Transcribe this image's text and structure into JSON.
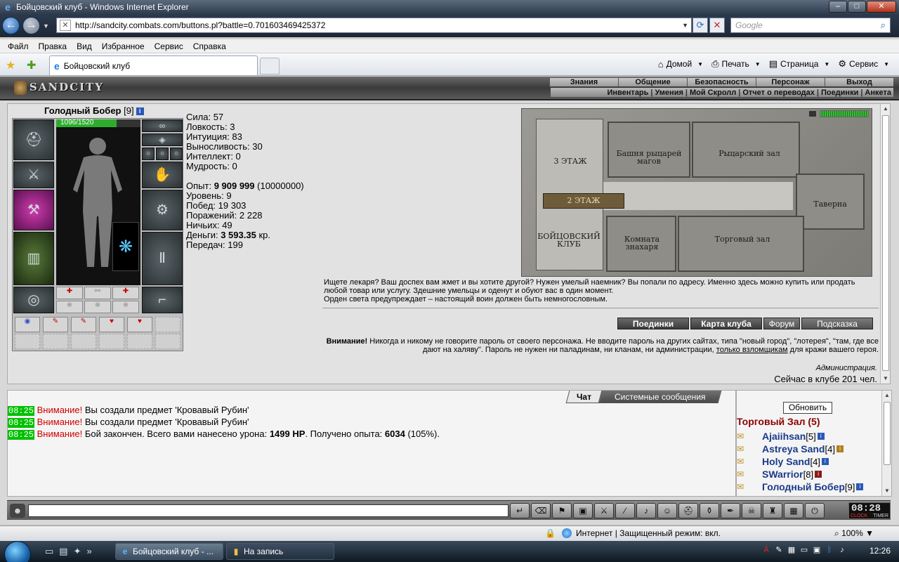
{
  "window": {
    "title": "Бойцовский клуб - Windows Internet Explorer",
    "min": "–",
    "max": "□",
    "close": "✕"
  },
  "address": {
    "url": "http://sandcity.combats.com/buttons.pl?battle=0.701603469425372",
    "search_placeholder": "Google"
  },
  "menu": [
    "Файл",
    "Правка",
    "Вид",
    "Избранное",
    "Сервис",
    "Справка"
  ],
  "tab": {
    "title": "Бойцовский клуб"
  },
  "commandbar": {
    "home": "Домой",
    "print": "Печать",
    "page": "Страница",
    "tools": "Сервис"
  },
  "game": {
    "logo": "SANDCITY",
    "top_menu": [
      "Знания",
      "Общение",
      "Безопасность",
      "Персонаж",
      "Выход"
    ],
    "sub_menu": [
      "Инвентарь",
      "Умения",
      "Мой Скролл",
      "Отчет о переводах",
      "Поединки",
      "Анкета"
    ],
    "character": {
      "name": "Голодный Бобер",
      "level": "[9]",
      "hp": "1096/1520",
      "hp_fraction": 0.72
    },
    "stats": [
      {
        "label": "Сила: ",
        "value": "57"
      },
      {
        "label": "Ловкость: ",
        "value": "3"
      },
      {
        "label": "Интуиция: ",
        "value": "83"
      },
      {
        "label": "Выносливость: ",
        "value": "30"
      },
      {
        "label": "Интеллект: ",
        "value": "0"
      },
      {
        "label": "Мудрость: ",
        "value": "0"
      }
    ],
    "exp": {
      "label": "Опыт: ",
      "value": "9 909 999",
      "next": " (10000000)"
    },
    "info": [
      {
        "label": "Уровень: ",
        "value": "9"
      },
      {
        "label": "Побед: ",
        "value": "19 303"
      },
      {
        "label": "Поражений: ",
        "value": "2 228"
      },
      {
        "label": "Ничьих: ",
        "value": "49"
      }
    ],
    "money": {
      "label": "Деньги: ",
      "value": "3 593.35",
      "unit": " кр."
    },
    "transfers": {
      "label": "Передач: ",
      "value": "199"
    },
    "map": {
      "floor3": "3 ЭТАЖ",
      "floor2": "2 ЭТАЖ",
      "tower": "Башня рыцарей магов",
      "knight_hall": "Рыцарский зал",
      "tavern": "Таверна",
      "club": "БОЙЦОВСКИЙ КЛУБ",
      "healer": "Комната знахаря",
      "trade": "Торговый зал"
    },
    "description": [
      "Ищете лекаря? Ваш доспех вам жмет и вы хотите другой? Нужен умелый наемник? Вы попали по адресу. Именно здесь можно купить или продать любой товар или услугу. Здешние умельцы и оденут и обуют вас в один момент.",
      "Орден света предупреждает – настоящий воин должен быть немногословным."
    ],
    "buttons": [
      "Поединки",
      "Карта клуба",
      "Форум",
      "Подсказка"
    ],
    "warning": {
      "bold": "Внимание!",
      "text1": " Никогда и никому не говорите пароль от своего персонажа. Не вводите пароль на других сайтах, типа \"новый город\", \"лотерея\", \"там, где все дают на халяву\". Пароль не нужен ни паладинам, ни кланам, ни администрации, ",
      "link": "только взломщикам",
      "text2": " для кражи вашего героя.",
      "admin": "Администрация."
    },
    "online": "Сейчас в клубе 201 чел."
  },
  "chat": {
    "tab_chat": "Чат",
    "tab_system": "Системные сообщения",
    "lines": [
      {
        "time": "08:25",
        "warn": "Внимание!",
        "text": " Вы создали предмет 'Кровавый Рубин'"
      },
      {
        "time": "08:25",
        "warn": "Внимание!",
        "text": " Вы создали предмет 'Кровавый Рубин'"
      },
      {
        "time": "08:25",
        "warn": "Внимание!",
        "text_a": " Бой закончен. Всего вами нанесено урона: ",
        "dmg": "1499 HP",
        "text_b": ". Получено опыта: ",
        "exp": "6034",
        "text_c": " (105%)."
      }
    ]
  },
  "room": {
    "refresh": "Обновить",
    "title": "Торговый Зал (5)",
    "players": [
      {
        "name": "Ajaiihsan",
        "level": "[5]"
      },
      {
        "name": "Astreya Sand",
        "level": "[4]"
      },
      {
        "name": "Holy Sand",
        "level": "[4]"
      },
      {
        "name": "SWarrior",
        "level": "[8]"
      },
      {
        "name": "Голодный Бобер",
        "level": "[9]"
      }
    ]
  },
  "clock": {
    "time": "08:28",
    "sec": "08",
    "label1": "CLOCK",
    "label2": "TIMER"
  },
  "status": {
    "zone": "Интернет | Защищенный режим: вкл.",
    "zoom": "100%"
  },
  "taskbar": {
    "task1": "Бойцовский клуб - ...",
    "task2": "На запись",
    "time": "12:26"
  }
}
